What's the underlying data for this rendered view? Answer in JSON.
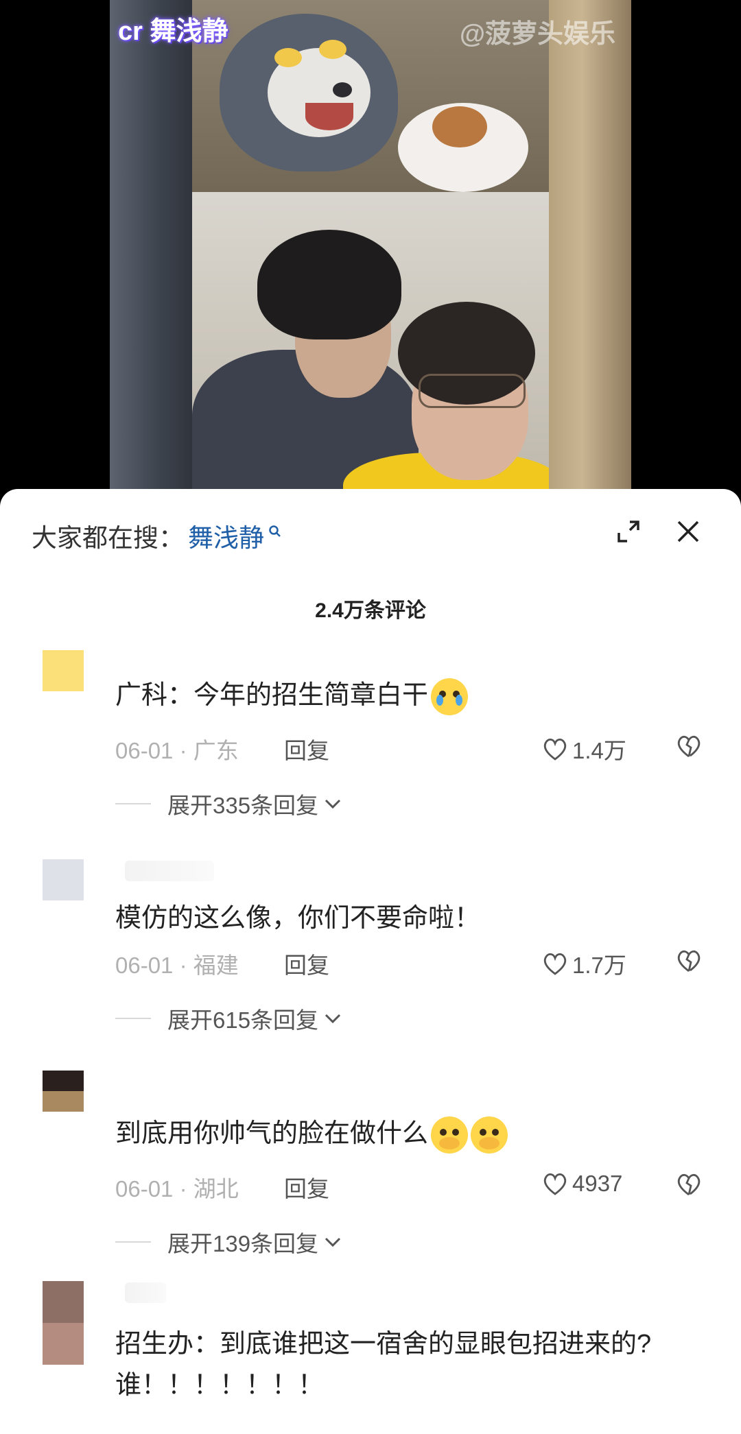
{
  "video": {
    "credit": "cr 舞浅静",
    "watermark": "@菠萝头娱乐"
  },
  "sheet": {
    "search_prefix": "大家都在搜：",
    "search_term": "舞浅静",
    "comment_count": "2.4万条评论"
  },
  "icons": {
    "search": "search-icon",
    "expand": "expand-icon",
    "close": "close-icon",
    "like": "heart-icon",
    "dislike": "broken-heart-icon"
  },
  "comments": [
    {
      "text": "广科：今年的招生简章白干",
      "emoji": "loudly-crying-face",
      "date": "06-01 · 广东",
      "reply": "回复",
      "likes": "1.4万",
      "expand": "展开335条回复"
    },
    {
      "text": "模仿的这么像，你们不要命啦！",
      "date": "06-01 · 福建",
      "reply": "回复",
      "likes": "1.7万",
      "expand": "展开615条回复"
    },
    {
      "text": "到底用你帅气的脸在做什么",
      "emoji": "face-holding-back-tears x2",
      "date": "06-01 · 湖北",
      "reply": "回复",
      "likes": "4937",
      "expand": "展开139条回复"
    },
    {
      "text_line1": "招生办：到底谁把这一宿舍的显眼包招进来的?",
      "text_line2": "谁！！！！！！！"
    }
  ],
  "colors": {
    "search_term": "#1f5fa8",
    "meta_gray": "#b0b0b0",
    "accent_yellow": "#f1c81e"
  }
}
